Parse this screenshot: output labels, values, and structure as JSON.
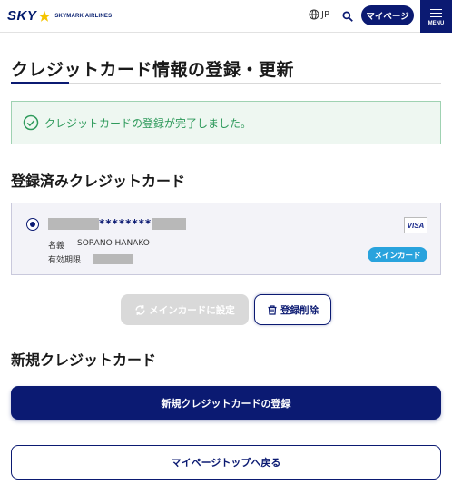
{
  "header": {
    "logo_text": "SKY",
    "logo_subtitle": "SKYMARK AIRLINES",
    "language": "JP",
    "mypage_label": "マイページ",
    "menu_label": "MENU",
    "brand_color": "#0b1a72",
    "star_color": "#f5c400",
    "icons": [
      "globe-icon",
      "search-icon",
      "hamburger-icon"
    ]
  },
  "page": {
    "title": "クレジットカード情報の登録・更新"
  },
  "alert": {
    "message": "クレジットカードの登録が完了しました。",
    "icon": "check-circle-icon",
    "color": "#2e9a5b"
  },
  "registered": {
    "section_title": "登録済みクレジットカード",
    "card": {
      "selected": true,
      "masked_number": "********",
      "name_label": "名義",
      "name_value": "SORANO HANAKO",
      "expiry_label": "有効期限",
      "brand": "VISA",
      "main_badge": "メインカード",
      "badge_color": "#29a3dd"
    },
    "set_main_label": "メインカードに設定",
    "delete_label": "登録削除"
  },
  "new_card": {
    "section_title": "新規クレジットカード",
    "register_label": "新規クレジットカードの登録"
  },
  "back_label": "マイページトップへ戻る"
}
